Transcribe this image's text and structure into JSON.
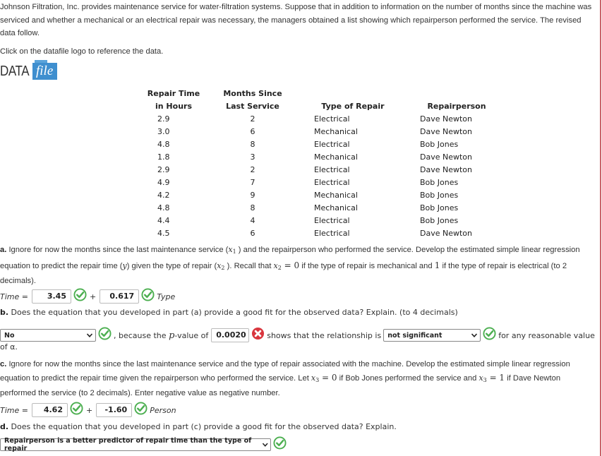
{
  "intro": {
    "paragraph": "Johnson Filtration, Inc. provides maintenance service for water-filtration systems. Suppose that in addition to information on the number of months since the machine was serviced and whether a mechanical or an electrical repair was necessary, the managers obtained a list showing which repairperson performed the service. The revised data follow.",
    "click_text": "Click on the datafile logo to reference the data."
  },
  "datafile_logo": {
    "data_word": "DATA",
    "file_word": "file",
    "color": "#3f8fcf"
  },
  "table": {
    "headers": [
      {
        "line1": "Repair Time",
        "line2": "in Hours"
      },
      {
        "line1": "Months Since",
        "line2": "Last Service"
      },
      {
        "line1": "",
        "line2": "Type of Repair"
      },
      {
        "line1": "",
        "line2": "Repairperson"
      }
    ],
    "rows": [
      [
        "2.9",
        "2",
        "Electrical",
        "Dave Newton"
      ],
      [
        "3.0",
        "6",
        "Mechanical",
        "Dave Newton"
      ],
      [
        "4.8",
        "8",
        "Electrical",
        "Bob Jones"
      ],
      [
        "1.8",
        "3",
        "Mechanical",
        "Dave Newton"
      ],
      [
        "2.9",
        "2",
        "Electrical",
        "Dave Newton"
      ],
      [
        "4.9",
        "7",
        "Electrical",
        "Bob Jones"
      ],
      [
        "4.2",
        "9",
        "Mechanical",
        "Bob Jones"
      ],
      [
        "4.8",
        "8",
        "Mechanical",
        "Bob Jones"
      ],
      [
        "4.4",
        "4",
        "Electrical",
        "Bob Jones"
      ],
      [
        "4.5",
        "6",
        "Electrical",
        "Dave Newton"
      ]
    ]
  },
  "part_a": {
    "label": "a.",
    "t1": " Ignore for now the months since the last maintenance service (",
    "x1": "x",
    "x1_sub": "1",
    "t2": " ) and the repairperson who performed the service. Develop the estimated simple linear regression equation to predict the repair time (",
    "y": "y",
    "t3": ") given the type of repair (",
    "x2": "x",
    "x2_sub": "2",
    "t4": " ). Recall that ",
    "x2b": "x",
    "x2b_sub": "2",
    "eq0": " = 0",
    "t5": " if the type of repair is mechanical and ",
    "one": "1",
    "t6": " if the type of repair is electrical (to 2 decimals).",
    "eq_label": "Time =",
    "intercept": "3.45",
    "plus": "+",
    "slope": "0.617",
    "var": "Type",
    "intercept_status": "correct",
    "slope_status": "correct"
  },
  "part_b": {
    "label": "b.",
    "question": " Does the equation that you developed in part (a) provide a good fit for the observed data? Explain. (to 4 decimals)",
    "select1": "No",
    "t1": ", because the ",
    "p": "p",
    "t2": "-value of ",
    "pvalue": "0.0020",
    "pvalue_status": "incorrect",
    "t3": " shows that the relationship is ",
    "select2": "not significant",
    "t4": " for any reasonable value",
    "t5": "of α."
  },
  "part_c": {
    "label": "c.",
    "t1": " Ignore for now the months since the last maintenance service and the type of repair associated with the machine. Develop the estimated simple linear regression equation to predict the repair time given the repairperson who performed the service. Let ",
    "x3": "x",
    "x3_sub": "3",
    "eq0": " = 0",
    "t2": " if Bob Jones performed the service and ",
    "x3b": "x",
    "x3b_sub": "3",
    "eq1": " = 1",
    "t3": " if Dave Newton performed the service (to 2 decimals). Enter negative value as negative number.",
    "eq_label": "Time =",
    "intercept": "4.62",
    "plus": "+",
    "slope": "-1.60",
    "var": "Person"
  },
  "part_d": {
    "label": "d.",
    "question": " Does the equation that you developed in part (c) provide a good fit for the observed data? Explain.",
    "select": "Repairperson is a better predictor of repair time than the type of repair"
  },
  "colors": {
    "correct": "#4caf50",
    "incorrect": "#d9363e",
    "accent_rule": "#c9636a"
  }
}
